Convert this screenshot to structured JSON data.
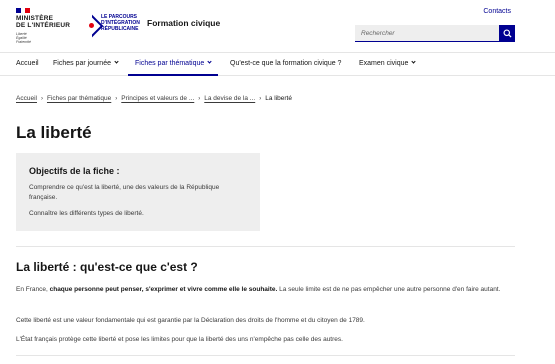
{
  "header": {
    "ministry": "MINISTÈRE\nDE L'INTÉRIEUR",
    "motto": "Liberté\nÉgalité\nFraternité",
    "partner": "LE PARCOURS\nD'INTÉGRATION\nRÉPUBLICAINE",
    "site_title": "Formation civique",
    "contacts": "Contacts",
    "search_placeholder": "Rechercher"
  },
  "nav": {
    "items": [
      {
        "label": "Accueil"
      },
      {
        "label": "Fiches par journée"
      },
      {
        "label": "Fiches par thématique"
      },
      {
        "label": "Qu'est-ce que la formation civique ?"
      },
      {
        "label": "Examen civique"
      }
    ]
  },
  "breadcrumb": {
    "items": [
      "Accueil",
      "Fiches par thématique",
      "Principes et valeurs de ...",
      "La devise de la ..."
    ],
    "current": "La liberté"
  },
  "page_title": "La liberté",
  "objectives": {
    "title": "Objectifs de la fiche :",
    "items": [
      "Comprendre ce qu'est la liberté, une des valeurs de la République française.",
      "Connaître les différents types de liberté."
    ]
  },
  "section": {
    "title": "La liberté : qu'est-ce que c'est ?",
    "p1_before": "En France, ",
    "p1_bold": "chaque personne peut penser, s'exprimer et vivre comme elle le souhaite.",
    "p1_after": " La seule limite est de ne pas empêcher une autre personne d'en faire autant.",
    "p2": "Cette liberté est une valeur fondamentale qui est garantie par la Déclaration des droits de l'homme et du citoyen de 1789.",
    "p3": "L'État français protège cette liberté et pose les limites pour que la liberté des uns n'empêche pas celle des autres."
  },
  "colors": {
    "accent": "#000091",
    "flag_red": "#e1000f",
    "panel": "#eeeeee"
  }
}
